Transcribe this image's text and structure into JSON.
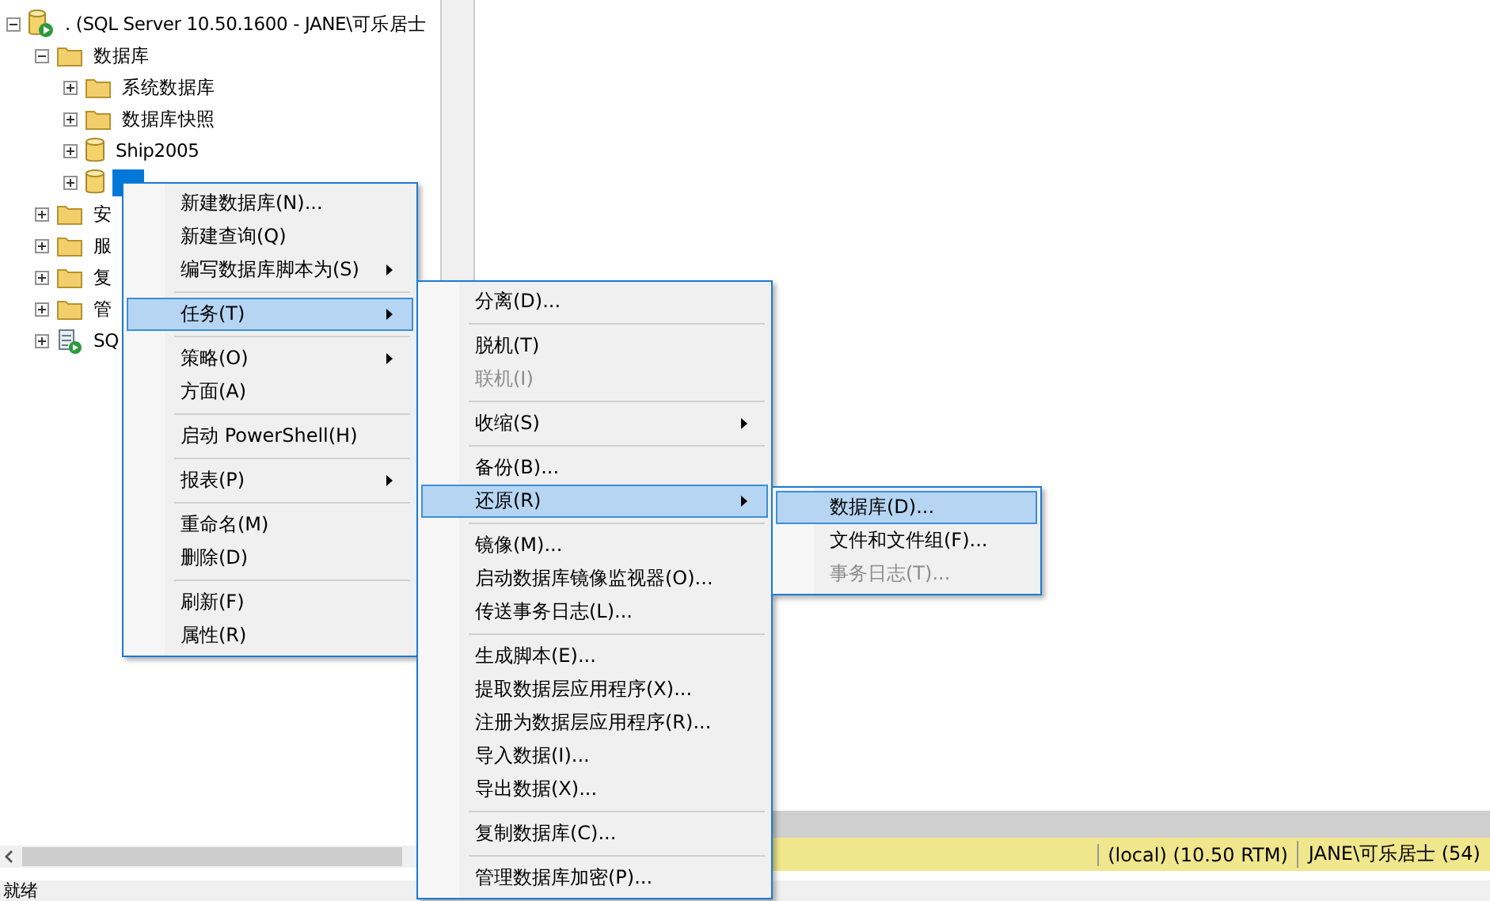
{
  "tree": {
    "nodes": [
      {
        "label": ". (SQL Server 10.50.1600 - JANE\\可乐居士",
        "kind": "server",
        "expanded": true,
        "selected": false,
        "children": [
          {
            "label": "数据库",
            "kind": "folder",
            "expanded": true,
            "selected": false,
            "children": [
              {
                "label": "系统数据库",
                "kind": "folder",
                "expanded": false,
                "selected": false
              },
              {
                "label": "数据库快照",
                "kind": "folder",
                "expanded": false,
                "selected": false
              },
              {
                "label": "Ship2005",
                "kind": "database",
                "expanded": false,
                "selected": false
              },
              {
                "kind": "database",
                "expanded": false,
                "selected": true
              }
            ]
          },
          {
            "label": "安",
            "kind": "folder",
            "expanded": false,
            "selected": false
          },
          {
            "label": "服",
            "kind": "folder",
            "expanded": false,
            "selected": false
          },
          {
            "label": "复",
            "kind": "folder",
            "expanded": false,
            "selected": false
          },
          {
            "label": "管",
            "kind": "folder",
            "expanded": false,
            "selected": false
          },
          {
            "label": "SQ",
            "kind": "agent",
            "expanded": false,
            "selected": false
          }
        ]
      }
    ]
  },
  "context_menu": {
    "items": [
      {
        "kind": "item",
        "label": "新建数据库(N)...",
        "submenu": false,
        "selected": false,
        "disabled": false
      },
      {
        "kind": "item",
        "label": "新建查询(Q)",
        "submenu": false,
        "selected": false,
        "disabled": false
      },
      {
        "kind": "item",
        "label": "编写数据库脚本为(S)",
        "submenu": true,
        "selected": false,
        "disabled": false
      },
      {
        "kind": "separator"
      },
      {
        "kind": "item",
        "label": "任务(T)",
        "submenu": true,
        "selected": true,
        "disabled": false
      },
      {
        "kind": "separator"
      },
      {
        "kind": "item",
        "label": "策略(O)",
        "submenu": true,
        "selected": false,
        "disabled": false
      },
      {
        "kind": "item",
        "label": "方面(A)",
        "submenu": false,
        "selected": false,
        "disabled": false
      },
      {
        "kind": "separator"
      },
      {
        "kind": "item",
        "label": "启动 PowerShell(H)",
        "submenu": false,
        "selected": false,
        "disabled": false
      },
      {
        "kind": "separator"
      },
      {
        "kind": "item",
        "label": "报表(P)",
        "submenu": true,
        "selected": false,
        "disabled": false
      },
      {
        "kind": "separator"
      },
      {
        "kind": "item",
        "label": "重命名(M)",
        "submenu": false,
        "selected": false,
        "disabled": false
      },
      {
        "kind": "item",
        "label": "删除(D)",
        "submenu": false,
        "selected": false,
        "disabled": false
      },
      {
        "kind": "separator"
      },
      {
        "kind": "item",
        "label": "刷新(F)",
        "submenu": false,
        "selected": false,
        "disabled": false
      },
      {
        "kind": "item",
        "label": "属性(R)",
        "submenu": false,
        "selected": false,
        "disabled": false
      }
    ]
  },
  "tasks_submenu": {
    "items": [
      {
        "kind": "item",
        "label": "分离(D)...",
        "submenu": false,
        "selected": false,
        "disabled": false
      },
      {
        "kind": "separator"
      },
      {
        "kind": "item",
        "label": "脱机(T)",
        "submenu": false,
        "selected": false,
        "disabled": false
      },
      {
        "kind": "item",
        "label": "联机(I)",
        "submenu": false,
        "selected": false,
        "disabled": true
      },
      {
        "kind": "separator"
      },
      {
        "kind": "item",
        "label": "收缩(S)",
        "submenu": true,
        "selected": false,
        "disabled": false
      },
      {
        "kind": "separator"
      },
      {
        "kind": "item",
        "label": "备份(B)...",
        "submenu": false,
        "selected": false,
        "disabled": false
      },
      {
        "kind": "item",
        "label": "还原(R)",
        "submenu": true,
        "selected": true,
        "disabled": false
      },
      {
        "kind": "separator"
      },
      {
        "kind": "item",
        "label": "镜像(M)...",
        "submenu": false,
        "selected": false,
        "disabled": false
      },
      {
        "kind": "item",
        "label": "启动数据库镜像监视器(O)...",
        "submenu": false,
        "selected": false,
        "disabled": false
      },
      {
        "kind": "item",
        "label": "传送事务日志(L)...",
        "submenu": false,
        "selected": false,
        "disabled": false
      },
      {
        "kind": "separator"
      },
      {
        "kind": "item",
        "label": "生成脚本(E)...",
        "submenu": false,
        "selected": false,
        "disabled": false
      },
      {
        "kind": "item",
        "label": "提取数据层应用程序(X)...",
        "submenu": false,
        "selected": false,
        "disabled": false
      },
      {
        "kind": "item",
        "label": "注册为数据层应用程序(R)...",
        "submenu": false,
        "selected": false,
        "disabled": false
      },
      {
        "kind": "item",
        "label": "导入数据(I)...",
        "submenu": false,
        "selected": false,
        "disabled": false
      },
      {
        "kind": "item",
        "label": "导出数据(X)...",
        "submenu": false,
        "selected": false,
        "disabled": false
      },
      {
        "kind": "separator"
      },
      {
        "kind": "item",
        "label": "复制数据库(C)...",
        "submenu": false,
        "selected": false,
        "disabled": false
      },
      {
        "kind": "separator"
      },
      {
        "kind": "item",
        "label": "管理数据库加密(P)...",
        "submenu": false,
        "selected": false,
        "disabled": false
      }
    ]
  },
  "restore_submenu": {
    "items": [
      {
        "kind": "item",
        "label": "数据库(D)...",
        "submenu": false,
        "selected": true,
        "disabled": false
      },
      {
        "kind": "item",
        "label": "文件和文件组(F)...",
        "submenu": false,
        "selected": false,
        "disabled": false
      },
      {
        "kind": "item",
        "label": "事务日志(T)...",
        "submenu": false,
        "selected": false,
        "disabled": true
      }
    ]
  },
  "connection_bar": {
    "server": "(local) (10.50 RTM)",
    "user": "JANE\\可乐居士 (54)"
  },
  "status_bar": {
    "text": "就绪"
  }
}
